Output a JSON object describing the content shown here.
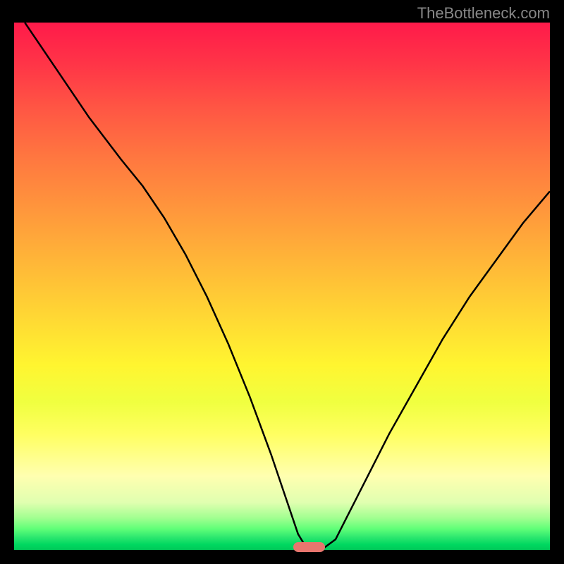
{
  "watermark": "TheBottleneck.com",
  "chart_data": {
    "type": "line",
    "title": "",
    "xlabel": "",
    "ylabel": "",
    "xlim": [
      0,
      100
    ],
    "ylim": [
      0,
      100
    ],
    "curve_points": [
      {
        "x": 2,
        "y": 100
      },
      {
        "x": 8,
        "y": 91
      },
      {
        "x": 14,
        "y": 82
      },
      {
        "x": 20,
        "y": 74
      },
      {
        "x": 24,
        "y": 69
      },
      {
        "x": 28,
        "y": 63
      },
      {
        "x": 32,
        "y": 56
      },
      {
        "x": 36,
        "y": 48
      },
      {
        "x": 40,
        "y": 39
      },
      {
        "x": 44,
        "y": 29
      },
      {
        "x": 48,
        "y": 18
      },
      {
        "x": 51,
        "y": 9
      },
      {
        "x": 53,
        "y": 3
      },
      {
        "x": 54.5,
        "y": 0.5
      },
      {
        "x": 58,
        "y": 0.5
      },
      {
        "x": 60,
        "y": 2
      },
      {
        "x": 62,
        "y": 6
      },
      {
        "x": 66,
        "y": 14
      },
      {
        "x": 70,
        "y": 22
      },
      {
        "x": 75,
        "y": 31
      },
      {
        "x": 80,
        "y": 40
      },
      {
        "x": 85,
        "y": 48
      },
      {
        "x": 90,
        "y": 55
      },
      {
        "x": 95,
        "y": 62
      },
      {
        "x": 100,
        "y": 68
      }
    ],
    "marker": {
      "x": 55,
      "y": 0
    }
  }
}
